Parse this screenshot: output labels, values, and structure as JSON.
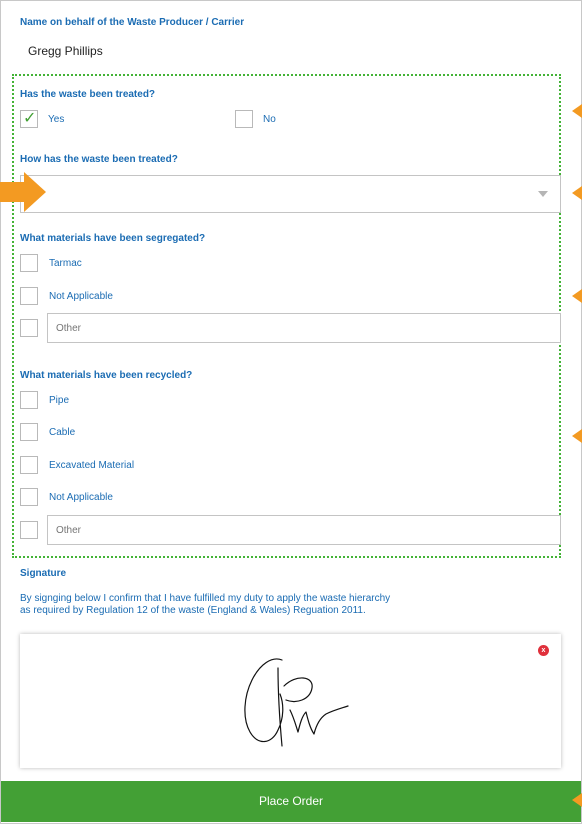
{
  "producer": {
    "label": "Name on behalf of the Waste Producer / Carrier",
    "name": "Gregg Phillips"
  },
  "treated": {
    "label": "Has the waste been treated?",
    "options": [
      {
        "label": "Yes",
        "checked": true
      },
      {
        "label": "No",
        "checked": false
      }
    ]
  },
  "treatment_method": {
    "label": "How has the waste been treated?",
    "value": ""
  },
  "segregated": {
    "label": "What materials have been segregated?",
    "items": [
      "Tarmac",
      "Not Applicable"
    ],
    "other_placeholder": "Other"
  },
  "recycled": {
    "label": "What materials have been recycled?",
    "items": [
      "Pipe",
      "Cable",
      "Excavated Material",
      "Not Applicable"
    ],
    "other_placeholder": "Other"
  },
  "signature": {
    "label": "Signature",
    "text_line1": "By signging below I confirm that I have fulfilled my duty to apply the waste hierarchy",
    "text_line2": "as required by Regulation 12 of the waste (England & Wales) Reguation 2011.",
    "clear_label": "x"
  },
  "actions": {
    "place_order": "Place Order"
  },
  "colors": {
    "accent_blue": "#1b6cb3",
    "success_green": "#43a035",
    "highlight_orange": "#f39a22",
    "clear_red": "#e0303b"
  }
}
